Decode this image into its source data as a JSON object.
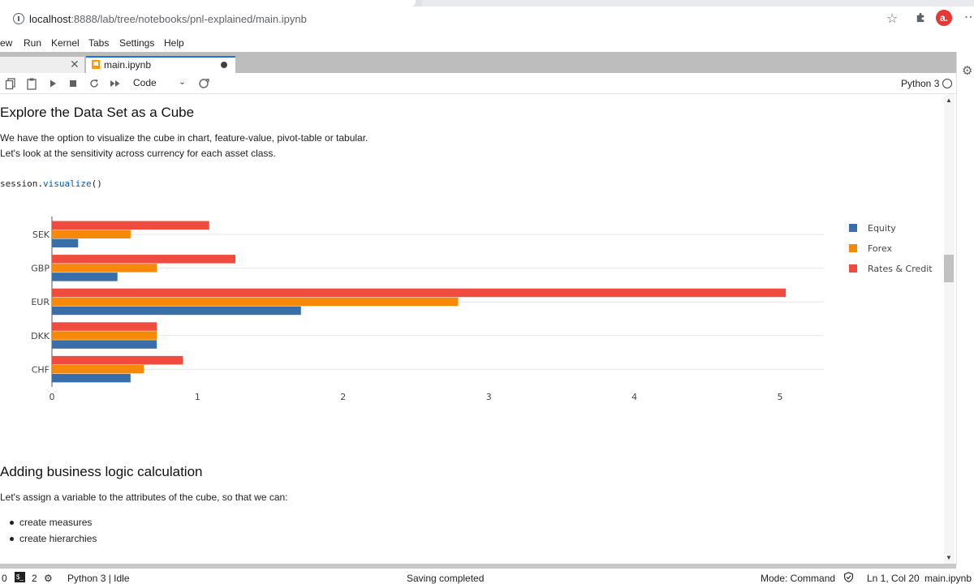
{
  "browser": {
    "url_host": "localhost",
    "url_rest": ":8888/lab/tree/notebooks/pnl-explained/main.ipynb",
    "avatar_letter": "a."
  },
  "menubar": [
    "ew",
    "Run",
    "Kernel",
    "Tabs",
    "Settings",
    "Help"
  ],
  "dock": {
    "active_tab": "main.ipynb"
  },
  "toolbar": {
    "cell_type": "Code",
    "kernel_name": "Python 3"
  },
  "notebook": {
    "heading1": "Explore the Data Set as a Cube",
    "para1_line1": "We have the option to visualize the cube in chart, feature-value, pivot-table or tabular.",
    "para1_line2": "Let's look at the sensitivity across currency for each asset class.",
    "code_obj": "session.",
    "code_fn": "visualize",
    "code_args": "()",
    "heading2": "Adding business logic calculation",
    "para2": "Let's assign a variable to the attributes of the cube, so that we can:",
    "bullets": [
      "create measures",
      "create hierarchies"
    ]
  },
  "chart_data": {
    "type": "bar",
    "orientation": "horizontal",
    "categories": [
      "SEK",
      "GBP",
      "EUR",
      "DKK",
      "CHF"
    ],
    "series": [
      {
        "name": "Equity",
        "color": "#3a6ea8",
        "values": [
          0.18,
          0.45,
          1.71,
          0.72,
          0.54
        ]
      },
      {
        "name": "Forex",
        "color": "#f7890a",
        "values": [
          0.54,
          0.72,
          2.79,
          0.72,
          0.63
        ]
      },
      {
        "name": "Rates & Credit",
        "color": "#ef4c3f",
        "values": [
          1.08,
          1.26,
          5.04,
          0.72,
          0.9
        ]
      }
    ],
    "xticks": [
      "0",
      "1",
      "2",
      "3",
      "4",
      "5"
    ],
    "xlim": [
      0,
      5.3
    ],
    "grid": true,
    "legend_position": "right"
  },
  "statusbar": {
    "count_a": "0",
    "count_b": "2",
    "kernel_status": "Python 3 | Idle",
    "saving": "Saving completed",
    "mode": "Mode: Command",
    "position": "Ln 1, Col 20",
    "filename": "main.ipynb"
  }
}
